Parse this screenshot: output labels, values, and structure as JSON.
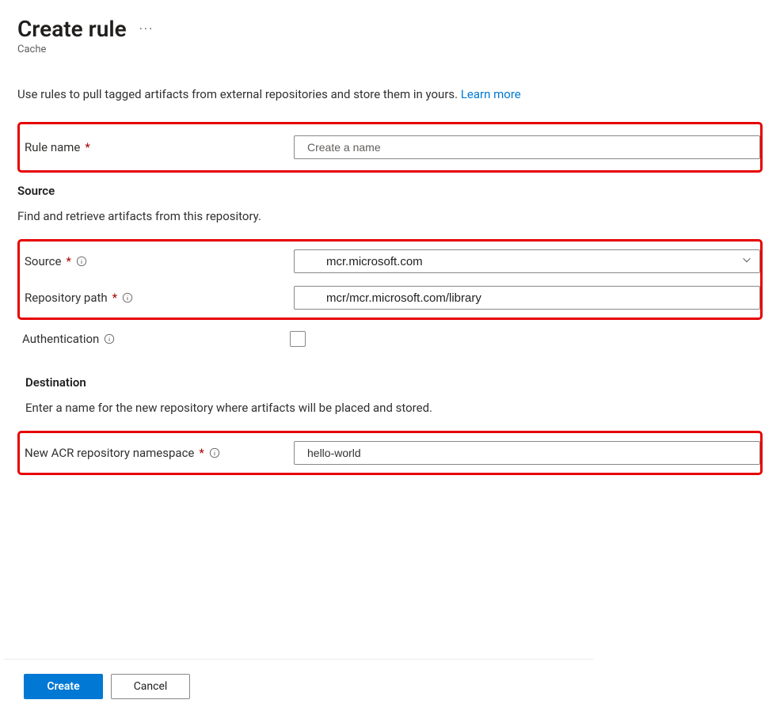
{
  "header": {
    "title": "Create rule",
    "subtitle": "Cache"
  },
  "intro": {
    "text": "Use rules to pull tagged artifacts from external repositories and store them in yours. ",
    "link_label": "Learn more"
  },
  "fields": {
    "rule_name": {
      "label": "Rule name",
      "placeholder": "Create a name",
      "value": ""
    }
  },
  "source": {
    "title": "Source",
    "description": "Find and retrieve artifacts from this repository.",
    "source_field": {
      "label": "Source",
      "value": "mcr.microsoft.com"
    },
    "repo_path": {
      "label": "Repository path",
      "value": "mcr/mcr.microsoft.com/library"
    },
    "authentication": {
      "label": "Authentication",
      "checked": false
    }
  },
  "destination": {
    "title": "Destination",
    "description": "Enter a name for the new repository where artifacts will be placed and stored.",
    "namespace": {
      "label": "New ACR repository namespace",
      "value": "hello-world"
    }
  },
  "footer": {
    "create_label": "Create",
    "cancel_label": "Cancel"
  }
}
